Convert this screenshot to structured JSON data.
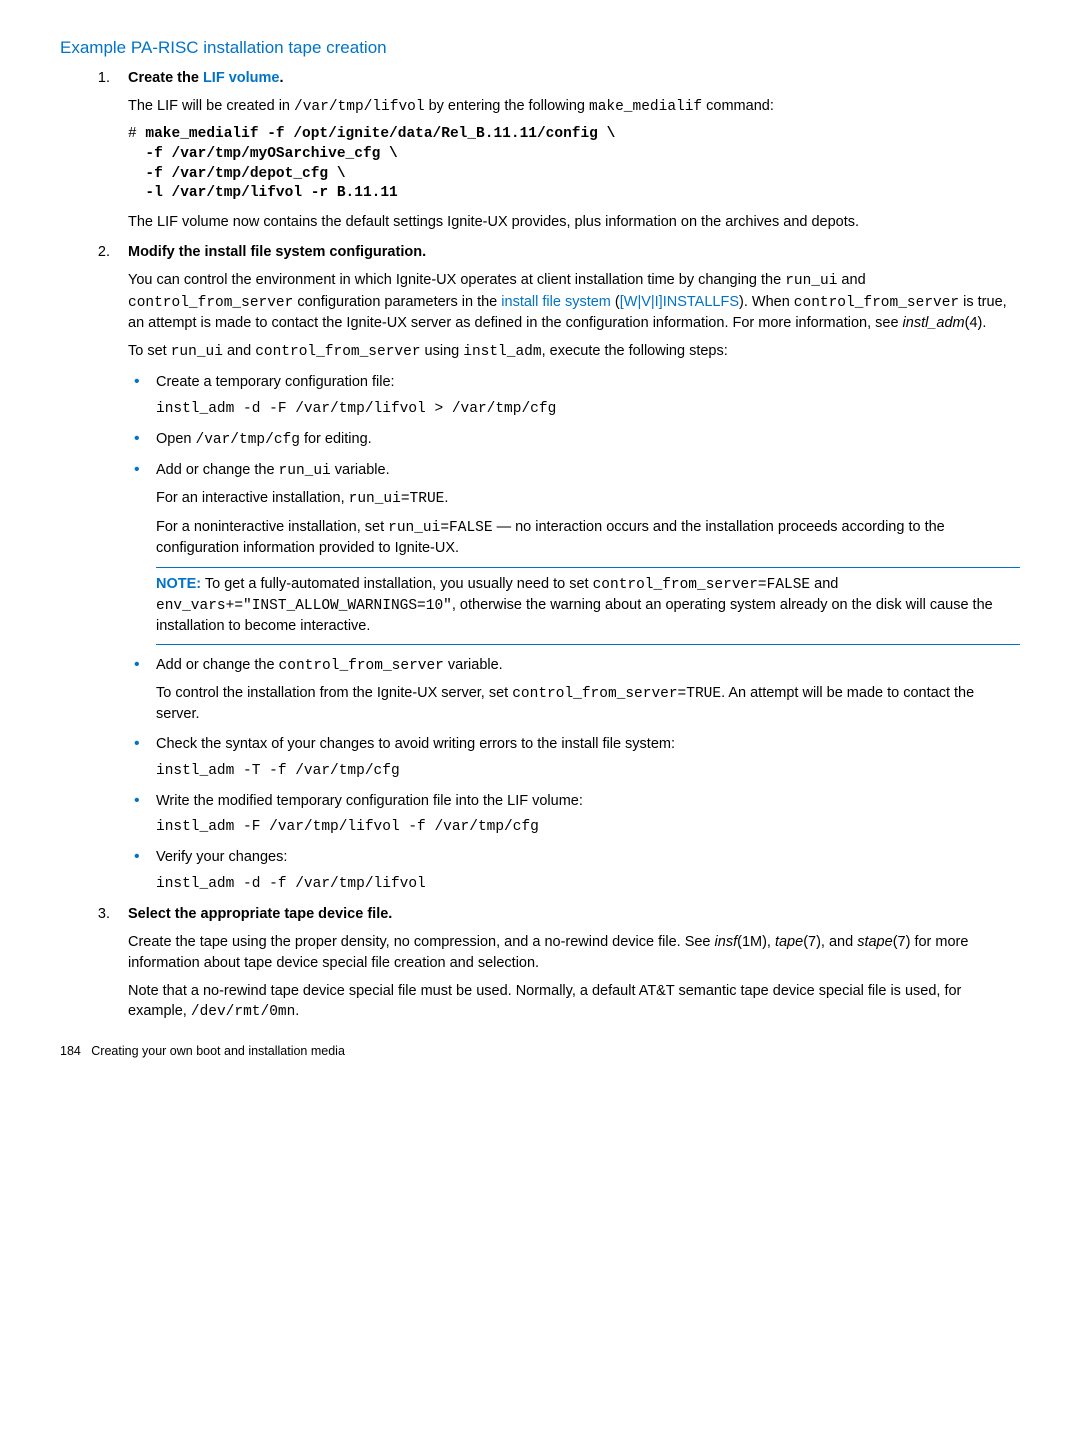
{
  "heading": "Example PA-RISC installation tape creation",
  "steps": {
    "s1": {
      "num": "1.",
      "title_pre": "Create the ",
      "title_link": "LIF volume",
      "title_post": ".",
      "p1a": "The LIF will be created in ",
      "p1b": "/var/tmp/lifvol",
      "p1c": " by entering the following ",
      "p1d": "make_medialif",
      "p1e": " command:",
      "code": "# make_medialif -f /opt/ignite/data/Rel_B.11.11/config \\\n  -f /var/tmp/myOSarchive_cfg \\\n  -f /var/tmp/depot_cfg \\\n  -l /var/tmp/lifvol -r B.11.11",
      "p2": "The LIF volume now contains the default settings Ignite-UX provides, plus information on the archives and depots."
    },
    "s2": {
      "num": "2.",
      "title": "Modify the install file system configuration.",
      "p1a": "You can control the environment in which Ignite-UX operates at client installation time by changing the ",
      "p1b": "run_ui",
      "p1c": " and  ",
      "p1d": "control_from_server",
      "p1e": " configuration parameters in the ",
      "p1_link1": "install file system",
      "p1f": " (",
      "p1_link2": "[W|V|I]INSTALLFS",
      "p1g": "). When ",
      "p1h": "control_from_server",
      "p1i": " is true, an attempt is made to contact the Ignite-UX server as defined in the configuration information. For more information, see ",
      "p1j": "instl_adm",
      "p1k": "(4).",
      "p2a": "To set ",
      "p2b": "run_ui",
      "p2c": " and ",
      "p2d": "control_from_server",
      "p2e": " using ",
      "p2f": "instl_adm",
      "p2g": ", execute the following steps:",
      "b1": {
        "t": "Create a temporary configuration file:",
        "code": "instl_adm -d -F /var/tmp/lifvol > /var/tmp/cfg"
      },
      "b2": {
        "a": "Open ",
        "b": "/var/tmp/cfg",
        "c": " for editing."
      },
      "b3": {
        "a": "Add or change the ",
        "b": "run_ui",
        "c": " variable.",
        "p1a": "For an interactive installation, ",
        "p1b": "run_ui=TRUE",
        "p1c": ".",
        "p2a": "For a noninteractive installation, set ",
        "p2b": "run_ui=FALSE",
        "p2c": " — no interaction occurs and the installation proceeds according to the configuration information provided to Ignite-UX.",
        "note_label": "NOTE:",
        "note_a": "   To get a fully-automated installation, you usually need to set ",
        "note_b": "control_from_server=FALSE",
        "note_c": " and ",
        "note_d": "env_vars+=\"INST_ALLOW_WARNINGS=10\"",
        "note_e": ", otherwise the warning about an operating system already on the disk will cause the installation to become interactive."
      },
      "b4": {
        "a": "Add or change the ",
        "b": "control_from_server",
        "c": " variable.",
        "p1a": "To control the installation from the Ignite-UX server, set ",
        "p1b": "control_from_server=TRUE",
        "p1c": ". An attempt will be made to contact the server."
      },
      "b5": {
        "t": "Check the syntax of your changes to avoid writing errors to the install file system:",
        "code": "instl_adm -T -f /var/tmp/cfg"
      },
      "b6": {
        "t": "Write the modified temporary configuration file into the LIF volume:",
        "code": "instl_adm -F /var/tmp/lifvol -f /var/tmp/cfg"
      },
      "b7": {
        "t": "Verify your changes:",
        "code": "instl_adm -d -f /var/tmp/lifvol"
      }
    },
    "s3": {
      "num": "3.",
      "title": "Select the appropriate tape device file.",
      "p1a": "Create the tape using the proper density, no compression, and a no-rewind device file. See ",
      "p1b": "insf",
      "p1c": "(1M), ",
      "p1d": "tape",
      "p1e": "(7), and ",
      "p1f": "stape",
      "p1g": "(7) for more information about tape device special file creation and selection.",
      "p2a": "Note that a no-rewind tape device special file must be used. Normally, a default AT&T semantic tape device special file is used, for example, ",
      "p2b": "/dev/rmt/0mn",
      "p2c": "."
    }
  },
  "footer": {
    "page": "184",
    "text": "Creating your own boot and installation media"
  }
}
